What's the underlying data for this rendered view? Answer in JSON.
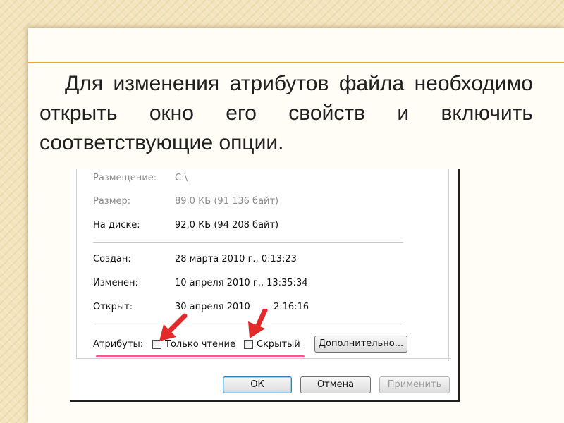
{
  "slide": {
    "text": "Для изменения атрибутов файла необходимо открыть окно его свойств и включить соответствующие опции."
  },
  "dialog": {
    "rows": [
      {
        "label": "Размещение:",
        "value": "C:\\"
      },
      {
        "label": "Размер:",
        "value": "89,0 КБ (91 136 байт)"
      },
      {
        "label": "На диске:",
        "value": "92,0 КБ (94 208 байт)"
      },
      {
        "label": "Создан:",
        "value": "28 марта 2010 г., 0:13:23"
      },
      {
        "label": "Изменен:",
        "value": "10 апреля 2010 г., 13:35:34"
      },
      {
        "label": "Открыт:",
        "value": "30 апреля 2010",
        "value_tail": "2:16:16"
      }
    ],
    "attributes_label": "Атрибуты:",
    "readonly_label": "Только чтение",
    "hidden_label": "Скрытый",
    "advanced_button": "Дополнительно...",
    "ok_button": "ОК",
    "cancel_button": "Отмена",
    "apply_button": "Применить"
  },
  "colors": {
    "accent_rule": "#e6a928",
    "arrow": "#e12a2a",
    "highlight_underline": "#f13a7d"
  }
}
